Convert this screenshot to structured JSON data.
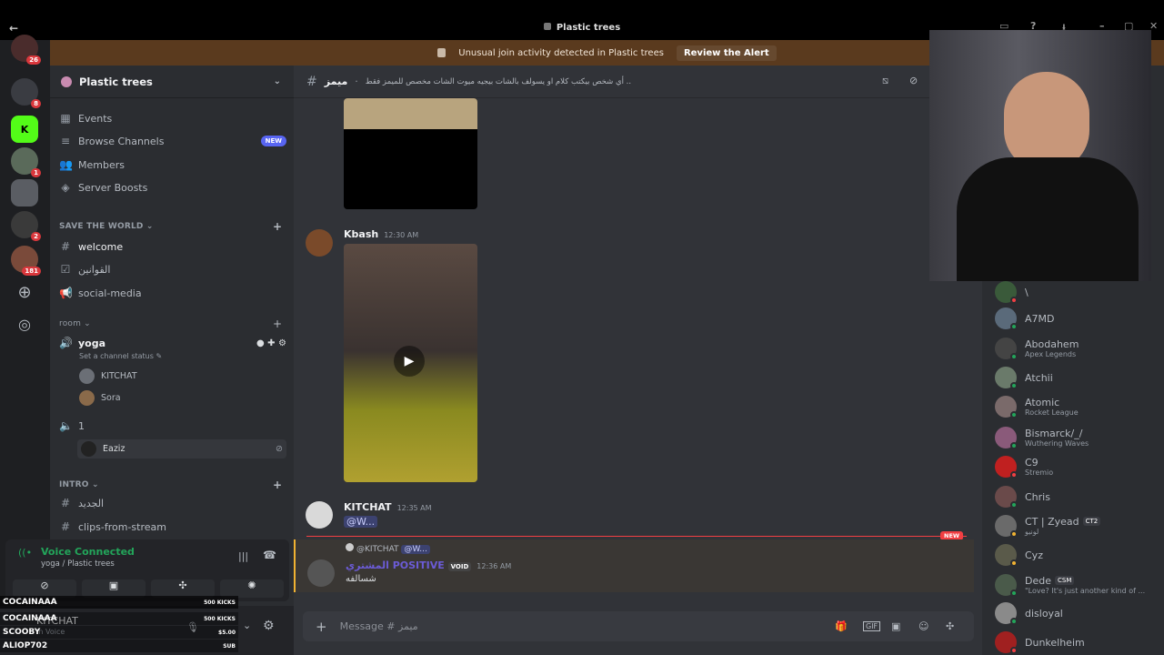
{
  "window": {
    "title": "Plastic trees"
  },
  "alert": {
    "text": "Unusual join activity detected in Plastic trees",
    "button": "Review the Alert"
  },
  "rail": {
    "badges": [
      "8",
      "1",
      "2",
      "181"
    ],
    "top_badge": "26"
  },
  "server": {
    "name": "Plastic trees"
  },
  "sidebar": {
    "top_items": [
      {
        "label": "Events",
        "icon": "calendar-icon"
      },
      {
        "label": "Browse Channels",
        "icon": "browse-icon",
        "badge": "NEW"
      },
      {
        "label": "Members",
        "icon": "members-icon"
      },
      {
        "label": "Server Boosts",
        "icon": "boost-icon"
      }
    ],
    "categories": [
      {
        "name": "SAVE THE WORLD"
      },
      {
        "name": "room"
      },
      {
        "name": "INTRO"
      }
    ],
    "channels": {
      "welcome": "welcome",
      "rules": "القوانين",
      "social": "social-media",
      "yoga": "yoga",
      "yoga_status": "Set a channel status",
      "voice1": "1",
      "new": "الجديد",
      "clips": "clips-from-stream"
    },
    "voice_users": {
      "yoga": [
        "KITCHAT",
        "Sora"
      ],
      "v1": [
        "Eaziz"
      ]
    }
  },
  "voice": {
    "status": "Voice Connected",
    "location": "yoga / Plastic trees"
  },
  "userbar": {
    "name": "KITCHAT",
    "sub": "In Voice"
  },
  "kicks": [
    {
      "name": "COCAINAAA",
      "amount": "500 KICKS"
    },
    {
      "name": "COCAINAAA",
      "amount": "500 KICKS"
    },
    {
      "name": "SCOOBY",
      "amount": "$5.00"
    },
    {
      "name": "ALIOP702",
      "amount": "SUB"
    }
  ],
  "chat": {
    "channel": "ميمز",
    "topic": "أي شخص بيكتب كلام او يسولف بالشات بيجيه ميوت الشات مخصص للميمز فقط ..",
    "messages": [
      {
        "author": "Kbash",
        "time": "12:30 AM"
      },
      {
        "author": "KITCHAT",
        "time": "12:35 AM",
        "mention": "@W..."
      },
      {
        "reply_to": "@KITCHAT",
        "reply_mention": "@W...",
        "author": "المشتري POSITIVE",
        "tag": "VOID",
        "time": "12:36 AM",
        "text": "شسالفه"
      }
    ],
    "new_label": "NEW",
    "composer_placeholder": "Message # ميمز"
  },
  "members": [
    {
      "name": "\\",
      "activity": "",
      "status": "#f23f43"
    },
    {
      "name": "A7MD",
      "activity": "",
      "status": "#23a55a"
    },
    {
      "name": "Abodahem",
      "activity": "Apex Legends",
      "status": "#23a55a"
    },
    {
      "name": "Atchii",
      "activity": "",
      "status": "#23a55a"
    },
    {
      "name": "Atomic",
      "activity": "Rocket League",
      "status": "#23a55a"
    },
    {
      "name": "Bismarck/_/",
      "activity": "Wuthering Waves",
      "status": "#23a55a"
    },
    {
      "name": "C9",
      "activity": "Stremio",
      "status": "#f23f43"
    },
    {
      "name": "Chris",
      "activity": "",
      "status": "#23a55a"
    },
    {
      "name": "CT | Zyead",
      "tag": "CT2",
      "activity": "لونيو",
      "status": "#f0b232"
    },
    {
      "name": "Cyz",
      "activity": "",
      "status": "#f0b232"
    },
    {
      "name": "Dede",
      "tag": "CSM",
      "activity": "\"Love? It's just another kind of ...",
      "status": "#23a55a"
    },
    {
      "name": "disloyal",
      "activity": "",
      "status": "#23a55a"
    },
    {
      "name": "Dunkelheim",
      "activity": "",
      "status": "#f23f43"
    }
  ]
}
